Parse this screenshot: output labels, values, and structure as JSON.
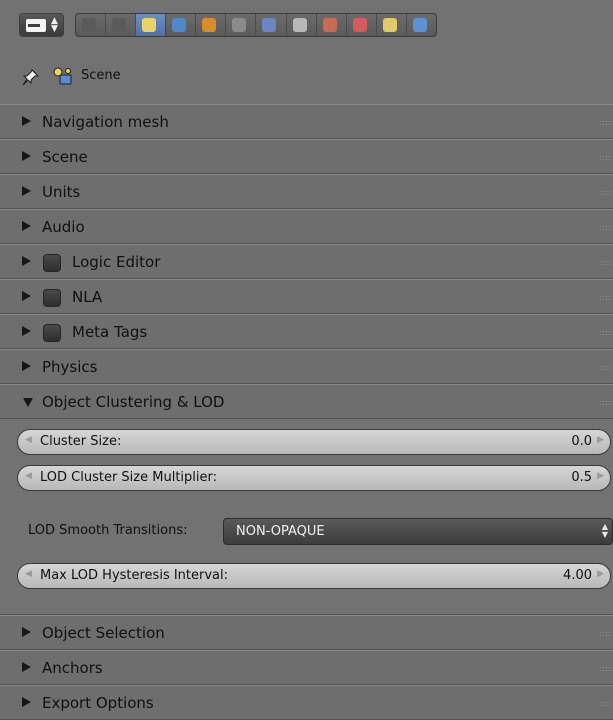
{
  "header": {
    "tabs": [
      {
        "name": "render-tab",
        "color": "#5a5a5a"
      },
      {
        "name": "render-layers-tab",
        "color": "#5a5a5a"
      },
      {
        "name": "scene-tab",
        "color": "#e8d36a"
      },
      {
        "name": "world-tab",
        "color": "#4e88c8"
      },
      {
        "name": "object-tab",
        "color": "#d98c2b"
      },
      {
        "name": "constraints-tab",
        "color": "#8b8b8b"
      },
      {
        "name": "modifiers-tab",
        "color": "#6b86c4"
      },
      {
        "name": "data-tab",
        "color": "#b8b8b8"
      },
      {
        "name": "material-tab",
        "color": "#c96a52"
      },
      {
        "name": "texture-tab",
        "color": "#d45c5c"
      },
      {
        "name": "particles-tab",
        "color": "#e2c96a"
      },
      {
        "name": "physics-tab",
        "color": "#5c92d4"
      }
    ]
  },
  "breadcrumb": {
    "label": "Scene"
  },
  "panels_top": [
    {
      "label": "Navigation mesh",
      "checkbox": false
    },
    {
      "label": "Scene",
      "checkbox": false
    },
    {
      "label": "Units",
      "checkbox": false
    },
    {
      "label": "Audio",
      "checkbox": false
    },
    {
      "label": "Logic Editor",
      "checkbox": true
    },
    {
      "label": "NLA",
      "checkbox": true
    },
    {
      "label": "Meta Tags",
      "checkbox": true
    },
    {
      "label": "Physics",
      "checkbox": false
    }
  ],
  "lod_panel": {
    "title": "Object Clustering & LOD",
    "cluster_size": {
      "label": "Cluster Size:",
      "value": "0.0"
    },
    "lod_multiplier": {
      "label": "LOD Cluster Size Multiplier:",
      "value": "0.5"
    },
    "smooth_transitions": {
      "label": "LOD Smooth Transitions:",
      "value": "NON-OPAQUE"
    },
    "hysteresis": {
      "label": "Max LOD Hysteresis Interval:",
      "value": "4.00"
    }
  },
  "panels_bottom": [
    {
      "label": "Object Selection"
    },
    {
      "label": "Anchors"
    },
    {
      "label": "Export Options"
    }
  ]
}
